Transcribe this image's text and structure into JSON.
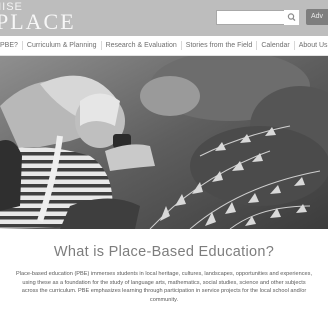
{
  "header": {
    "logo_line1": "MISE",
    "logo_line2": "PLACE",
    "search": {
      "value": "",
      "placeholder": ""
    },
    "login_label": "Adv"
  },
  "nav": {
    "items": [
      "PBE?",
      "Curriculum & Planning",
      "Research & Evaluation",
      "Stories from the Field",
      "Calendar",
      "About Us"
    ]
  },
  "hero": {
    "alt": ""
  },
  "main": {
    "heading": "What is Place-Based Education?",
    "description": "Place-based education (PBE) immerses students in local heritage, cultures, landscapes, opportunities and experiences, using these as a foundation for the study of language arts, mathematics, social studies, science and other subjects across the curriculum. PBE emphasizes learning through participation in service projects for the local school and/or community."
  },
  "colors": {
    "header_bg": "#bdbdbd",
    "logo_text": "#f7f7f7",
    "nav_text": "#6f6f6f",
    "heading_text": "#7d7d7d",
    "body_text": "#5a5a5a"
  }
}
